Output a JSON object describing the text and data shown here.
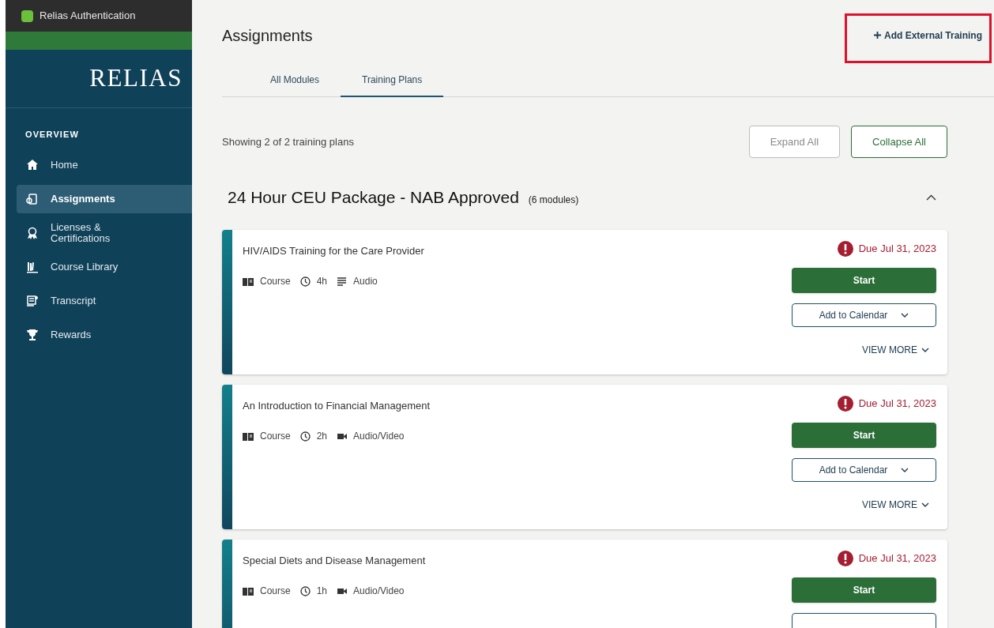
{
  "browser_tab": {
    "title": "Relias Authentication"
  },
  "sidebar": {
    "logo": "RELIAS",
    "section": "OVERVIEW",
    "items": [
      {
        "label": "Home",
        "kind": "home",
        "selected": false
      },
      {
        "label": "Assignments",
        "kind": "assignments",
        "selected": true
      },
      {
        "label": "Licenses & Certifications",
        "kind": "award",
        "selected": false
      },
      {
        "label": "Course Library",
        "kind": "library",
        "selected": false
      },
      {
        "label": "Transcript",
        "kind": "transcript",
        "selected": false
      },
      {
        "label": "Rewards",
        "kind": "trophy",
        "selected": false
      }
    ]
  },
  "header": {
    "title": "Assignments",
    "action": "Add External Training",
    "action_highlighted": true
  },
  "tabs": [
    {
      "label": "All Modules",
      "selected": false
    },
    {
      "label": "Training Plans",
      "selected": true
    }
  ],
  "summary": "Showing 2 of 2 training plans",
  "buttons": [
    {
      "label": "Expand All",
      "disabled": true
    },
    {
      "label": "Collapse All",
      "disabled": false
    }
  ],
  "plan": {
    "title": "24 Hour CEU Package - NAB Approved",
    "count": "(6 modules)",
    "expanded": true,
    "modules": [
      {
        "title": "HIV/AIDS Training for the Care Provider",
        "type": "Course",
        "duration": "4h",
        "media": "Audio",
        "kind": "audio",
        "due": "Due Jul 31, 2023",
        "start": "Start",
        "calendar": "Add to Calendar",
        "more": "VIEW MORE"
      },
      {
        "title": "An Introduction to Financial Management",
        "type": "Course",
        "duration": "2h",
        "media": "Audio/Video",
        "kind": "video",
        "due": "Due Jul 31, 2023",
        "start": "Start",
        "calendar": "Add to Calendar",
        "more": "VIEW MORE"
      },
      {
        "title": "Special Diets and Disease Management",
        "type": "Course",
        "duration": "1h",
        "media": "Audio/Video",
        "kind": "video",
        "due": "Due Jul 31, 2023",
        "start": "Start"
      }
    ]
  }
}
